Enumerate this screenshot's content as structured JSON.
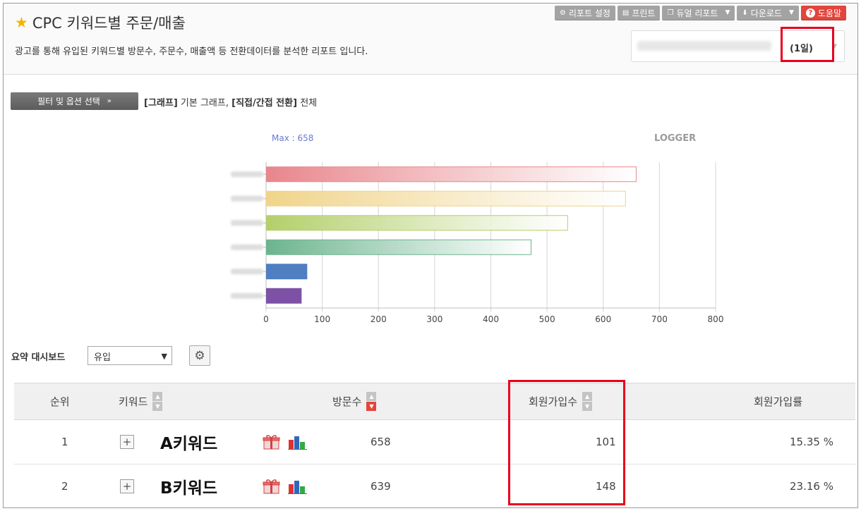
{
  "header": {
    "title": "CPC 키워드별 주문/매출",
    "subtitle": "광고를 통해 유입된 키워드별 방문수, 주문수, 매출액 등 전환데이터를 분석한 리포트 입니다.",
    "toolbar": {
      "report_settings": "리포트 설정",
      "print": "프린트",
      "dual_report": "듀얼 리포트",
      "download": "다운로드",
      "help": "도움말"
    },
    "date_range": {
      "days_label": "(1일)"
    }
  },
  "filter": {
    "button_label": "필터 및 옵션 선택",
    "graph_tag": "[그래프]",
    "graph_value": "기본 그래프,",
    "conversion_tag": "[직접/간접 전환]",
    "conversion_value": "전체"
  },
  "chart_data": {
    "type": "bar",
    "orientation": "horizontal",
    "max_label": "Max : 658",
    "brand_label": "LOGGER",
    "values": [
      658,
      639,
      536,
      471,
      72,
      62
    ],
    "xlim": [
      0,
      800
    ],
    "xticks": [
      0,
      100,
      200,
      300,
      400,
      500,
      600,
      700,
      800
    ],
    "grid": true,
    "colors": [
      "#e8868c",
      "#f0d48a",
      "#b3cf6a",
      "#6cb48e",
      "#4f7fc0",
      "#7d52a6"
    ]
  },
  "dashboard": {
    "label": "요약 대시보드",
    "selected": "유입"
  },
  "table": {
    "columns": {
      "rank": "순위",
      "keyword": "키워드",
      "visits": "방문수",
      "signups": "회원가입수",
      "signup_rate": "회원가입률"
    },
    "rows": [
      {
        "rank": "1",
        "keyword": "A키워드",
        "visits": "658",
        "signups": "101",
        "signup_rate": "15.35 %"
      },
      {
        "rank": "2",
        "keyword": "B키워드",
        "visits": "639",
        "signups": "148",
        "signup_rate": "23.16 %"
      }
    ]
  },
  "theme": {
    "accent_red": "#e8001e",
    "help_red": "#e2453b",
    "star": "#f5b400"
  }
}
